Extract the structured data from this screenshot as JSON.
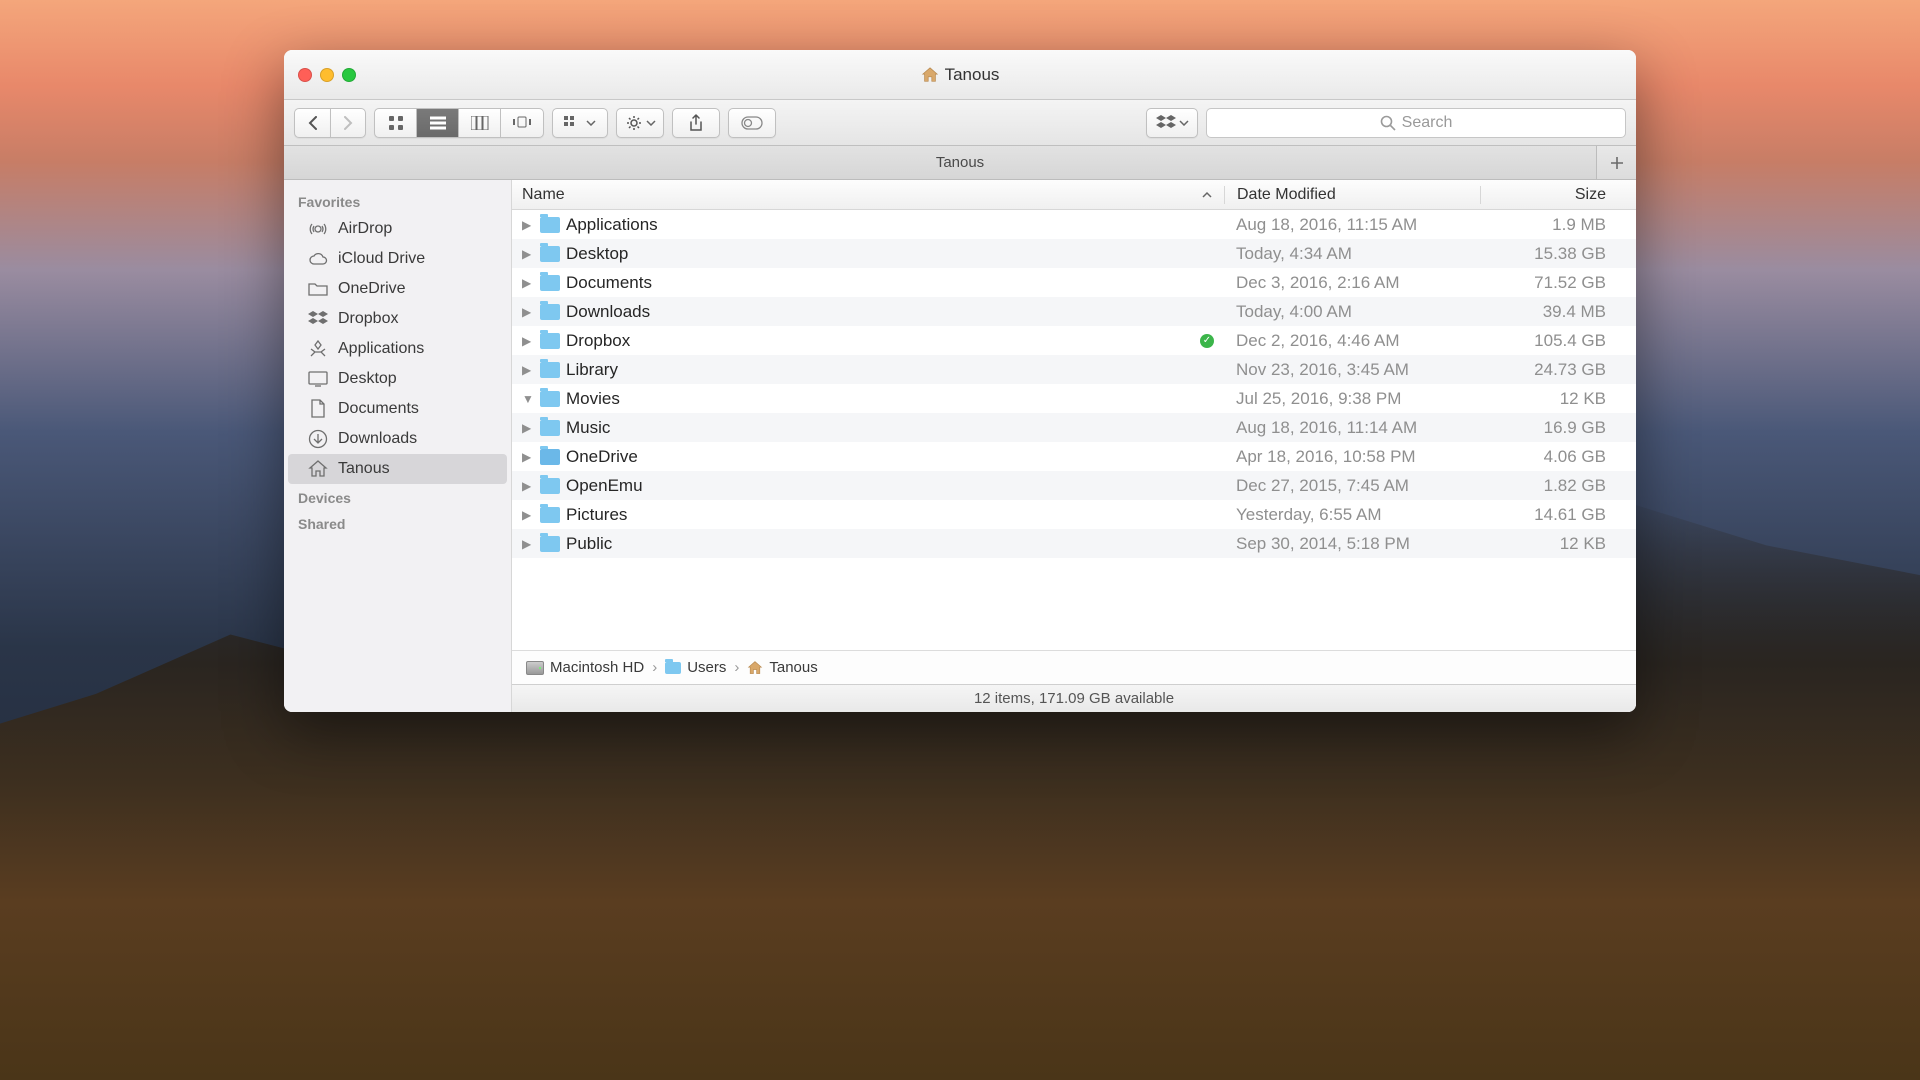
{
  "window": {
    "title": "Tanous",
    "icon": "home-icon"
  },
  "toolbar": {
    "search_placeholder": "Search"
  },
  "tabs": {
    "active": "Tanous"
  },
  "sidebar": {
    "sections": [
      {
        "title": "Favorites",
        "items": [
          {
            "label": "AirDrop",
            "icon": "airdrop-icon"
          },
          {
            "label": "iCloud Drive",
            "icon": "cloud-icon"
          },
          {
            "label": "OneDrive",
            "icon": "folder-icon"
          },
          {
            "label": "Dropbox",
            "icon": "dropbox-icon"
          },
          {
            "label": "Applications",
            "icon": "applications-icon"
          },
          {
            "label": "Desktop",
            "icon": "desktop-icon"
          },
          {
            "label": "Documents",
            "icon": "documents-icon"
          },
          {
            "label": "Downloads",
            "icon": "downloads-icon"
          },
          {
            "label": "Tanous",
            "icon": "home-icon",
            "selected": true
          }
        ]
      },
      {
        "title": "Devices",
        "items": []
      },
      {
        "title": "Shared",
        "items": []
      }
    ]
  },
  "columns": {
    "name": "Name",
    "date": "Date Modified",
    "size": "Size",
    "sort": "name-asc"
  },
  "files": [
    {
      "name": "Applications",
      "date": "Aug 18, 2016, 11:15 AM",
      "size": "1.9 MB",
      "expanded": false,
      "synced": false
    },
    {
      "name": "Desktop",
      "date": "Today, 4:34 AM",
      "size": "15.38 GB",
      "expanded": false,
      "synced": false
    },
    {
      "name": "Documents",
      "date": "Dec 3, 2016, 2:16 AM",
      "size": "71.52 GB",
      "expanded": false,
      "synced": false
    },
    {
      "name": "Downloads",
      "date": "Today, 4:00 AM",
      "size": "39.4 MB",
      "expanded": false,
      "synced": false
    },
    {
      "name": "Dropbox",
      "date": "Dec 2, 2016, 4:46 AM",
      "size": "105.4 GB",
      "expanded": false,
      "synced": true
    },
    {
      "name": "Library",
      "date": "Nov 23, 2016, 3:45 AM",
      "size": "24.73 GB",
      "expanded": false,
      "synced": false
    },
    {
      "name": "Movies",
      "date": "Jul 25, 2016, 9:38 PM",
      "size": "12 KB",
      "expanded": true,
      "synced": false
    },
    {
      "name": "Music",
      "date": "Aug 18, 2016, 11:14 AM",
      "size": "16.9 GB",
      "expanded": false,
      "synced": false
    },
    {
      "name": "OneDrive",
      "date": "Apr 18, 2016, 10:58 PM",
      "size": "4.06 GB",
      "expanded": false,
      "synced": false,
      "cloud": true
    },
    {
      "name": "OpenEmu",
      "date": "Dec 27, 2015, 7:45 AM",
      "size": "1.82 GB",
      "expanded": false,
      "synced": false
    },
    {
      "name": "Pictures",
      "date": "Yesterday, 6:55 AM",
      "size": "14.61 GB",
      "expanded": false,
      "synced": false
    },
    {
      "name": "Public",
      "date": "Sep 30, 2014, 5:18 PM",
      "size": "12 KB",
      "expanded": false,
      "synced": false
    }
  ],
  "path": [
    {
      "label": "Macintosh HD",
      "icon": "harddrive-icon"
    },
    {
      "label": "Users",
      "icon": "folder-icon"
    },
    {
      "label": "Tanous",
      "icon": "home-icon"
    }
  ],
  "status": "12 items, 171.09 GB available"
}
